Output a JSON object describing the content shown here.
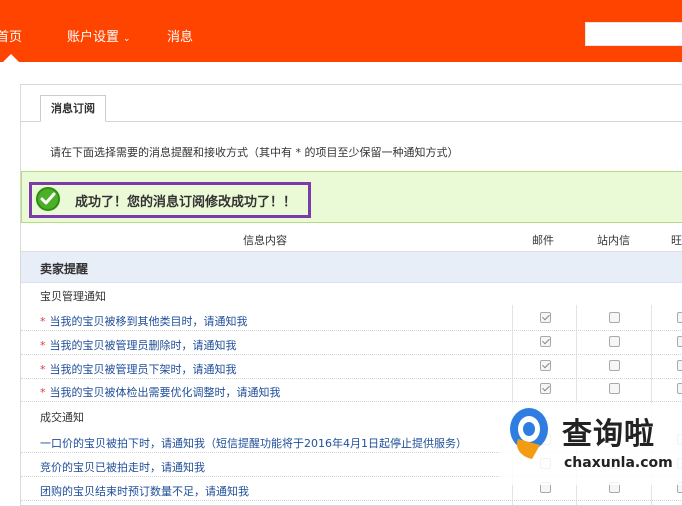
{
  "nav": {
    "home": "首页",
    "account_settings": "账户设置",
    "messages": "消息"
  },
  "tab": {
    "label": "消息订阅"
  },
  "intro": "请在下面选择需要的消息提醒和接收方式（其中有 * 的项目至少保留一种通知方式）",
  "success_message": "成功了！您的消息订阅修改成功了！！",
  "table": {
    "headers": [
      "信息内容",
      "邮件",
      "站内信",
      "旺"
    ],
    "section": "卖家提醒",
    "groups": [
      {
        "title": "宝贝管理通知",
        "rows": [
          {
            "text": "当我的宝贝被移到其他类目时，请通知我",
            "required": true,
            "mail": true,
            "site": false,
            "ww": false
          },
          {
            "text": "当我的宝贝被管理员删除时，请通知我",
            "required": true,
            "mail": true,
            "site": false,
            "ww": false
          },
          {
            "text": "当我的宝贝被管理员下架时，请通知我",
            "required": true,
            "mail": true,
            "site": false,
            "ww": false
          },
          {
            "text": "当我的宝贝被体检出需要优化调整时，请通知我",
            "required": true,
            "mail": true,
            "site": false,
            "ww": false
          }
        ]
      },
      {
        "title": "成交通知",
        "rows": [
          {
            "text": "一口价的宝贝被拍下时，请通知我（短信提醒功能将于2016年4月1日起停止提供服务）",
            "required": false,
            "mail": false,
            "site": false,
            "ww": true
          },
          {
            "text": "竞价的宝贝已被拍走时，请通知我",
            "required": false,
            "mail": false,
            "site": false,
            "ww": true
          },
          {
            "text": "团购的宝贝结束时预订数量不足，请通知我",
            "required": false,
            "mail": false,
            "site": false,
            "ww": true
          }
        ]
      }
    ]
  },
  "watermark": {
    "cn": "查询啦",
    "en": "chaxunla.com"
  },
  "colors": {
    "topbar": "#ff4400",
    "success_bg": "#ebfad6",
    "highlight": "#7b3ba8",
    "link": "#1f4e99"
  }
}
